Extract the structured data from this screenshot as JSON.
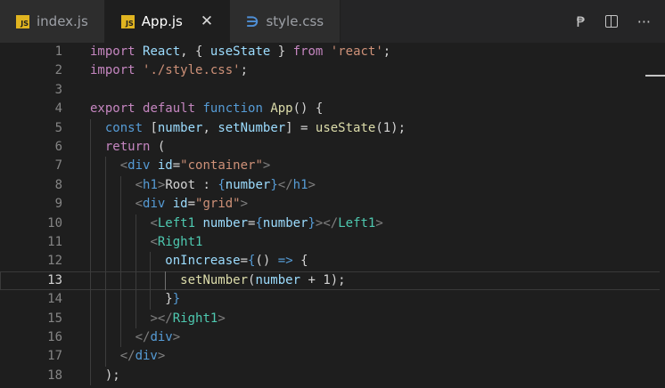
{
  "tabs": [
    {
      "label": "index.js",
      "icon": "js-icon",
      "active": false
    },
    {
      "label": "App.js",
      "icon": "js-icon",
      "active": true
    },
    {
      "label": "style.css",
      "icon": "css-icon",
      "active": false
    }
  ],
  "js_icon_text": "JS",
  "css_icon_glyph": "∋",
  "close_glyph": "✕",
  "more_glyph": "···",
  "preview_glyph": "₱",
  "colors": {
    "keyword": "#c586c0",
    "blue_keyword": "#569cd6",
    "string": "#ce9178",
    "variable": "#9cdcfe",
    "function": "#dcdcaa",
    "component": "#4ec9b0",
    "tag": "#808080",
    "text": "#d4d4d4"
  },
  "current_line": 13,
  "lines": [
    {
      "n": "1",
      "tokens": [
        [
          "import ",
          "keyword"
        ],
        [
          "React",
          "variable"
        ],
        [
          ", { ",
          "text"
        ],
        [
          "useState",
          "variable"
        ],
        [
          " } ",
          "text"
        ],
        [
          "from ",
          "keyword"
        ],
        [
          "'react'",
          "string"
        ],
        [
          ";",
          "text"
        ]
      ]
    },
    {
      "n": "2",
      "tokens": [
        [
          "import ",
          "keyword"
        ],
        [
          "'./style.css'",
          "string"
        ],
        [
          ";",
          "text"
        ]
      ]
    },
    {
      "n": "3",
      "tokens": []
    },
    {
      "n": "4",
      "tokens": [
        [
          "export ",
          "keyword"
        ],
        [
          "default ",
          "keyword"
        ],
        [
          "function ",
          "blue_keyword"
        ],
        [
          "App",
          "function"
        ],
        [
          "() {",
          "text"
        ]
      ]
    },
    {
      "n": "5",
      "tokens": [
        [
          "  ",
          "text"
        ],
        [
          "const ",
          "blue_keyword"
        ],
        [
          "[",
          "text"
        ],
        [
          "number",
          "variable"
        ],
        [
          ", ",
          "text"
        ],
        [
          "setNumber",
          "variable"
        ],
        [
          "] = ",
          "text"
        ],
        [
          "useState",
          "function"
        ],
        [
          "(1);",
          "text"
        ]
      ]
    },
    {
      "n": "6",
      "tokens": [
        [
          "  ",
          "text"
        ],
        [
          "return ",
          "keyword"
        ],
        [
          "(",
          "text"
        ]
      ]
    },
    {
      "n": "7",
      "tokens": [
        [
          "    ",
          "text"
        ],
        [
          "<",
          "tag"
        ],
        [
          "div ",
          "blue_keyword"
        ],
        [
          "id",
          "variable"
        ],
        [
          "=",
          "text"
        ],
        [
          "\"container\"",
          "string"
        ],
        [
          ">",
          "tag"
        ]
      ]
    },
    {
      "n": "8",
      "tokens": [
        [
          "      ",
          "text"
        ],
        [
          "<",
          "tag"
        ],
        [
          "h1",
          "blue_keyword"
        ],
        [
          ">",
          "tag"
        ],
        [
          "Root : ",
          "text"
        ],
        [
          "{",
          "blue_keyword"
        ],
        [
          "number",
          "variable"
        ],
        [
          "}",
          "blue_keyword"
        ],
        [
          "</",
          "tag"
        ],
        [
          "h1",
          "blue_keyword"
        ],
        [
          ">",
          "tag"
        ]
      ]
    },
    {
      "n": "9",
      "tokens": [
        [
          "      ",
          "text"
        ],
        [
          "<",
          "tag"
        ],
        [
          "div ",
          "blue_keyword"
        ],
        [
          "id",
          "variable"
        ],
        [
          "=",
          "text"
        ],
        [
          "\"grid\"",
          "string"
        ],
        [
          ">",
          "tag"
        ]
      ]
    },
    {
      "n": "10",
      "tokens": [
        [
          "        ",
          "text"
        ],
        [
          "<",
          "tag"
        ],
        [
          "Left1 ",
          "component"
        ],
        [
          "number",
          "variable"
        ],
        [
          "=",
          "text"
        ],
        [
          "{",
          "blue_keyword"
        ],
        [
          "number",
          "variable"
        ],
        [
          "}",
          "blue_keyword"
        ],
        [
          "></",
          "tag"
        ],
        [
          "Left1",
          "component"
        ],
        [
          ">",
          "tag"
        ]
      ]
    },
    {
      "n": "11",
      "tokens": [
        [
          "        ",
          "text"
        ],
        [
          "<",
          "tag"
        ],
        [
          "Right1",
          "component"
        ]
      ]
    },
    {
      "n": "12",
      "tokens": [
        [
          "          ",
          "text"
        ],
        [
          "onIncrease",
          "variable"
        ],
        [
          "=",
          "text"
        ],
        [
          "{",
          "blue_keyword"
        ],
        [
          "() ",
          "text"
        ],
        [
          "=> ",
          "blue_keyword"
        ],
        [
          "{",
          "text"
        ]
      ]
    },
    {
      "n": "13",
      "tokens": [
        [
          "            ",
          "text"
        ],
        [
          "setNumber",
          "function"
        ],
        [
          "(",
          "text"
        ],
        [
          "number",
          "variable"
        ],
        [
          " + 1);",
          "text"
        ]
      ]
    },
    {
      "n": "14",
      "tokens": [
        [
          "          ",
          "text"
        ],
        [
          "}",
          "text"
        ],
        [
          "}",
          "blue_keyword"
        ]
      ]
    },
    {
      "n": "15",
      "tokens": [
        [
          "        ",
          "text"
        ],
        [
          "></",
          "tag"
        ],
        [
          "Right1",
          "component"
        ],
        [
          ">",
          "tag"
        ]
      ]
    },
    {
      "n": "16",
      "tokens": [
        [
          "      ",
          "text"
        ],
        [
          "</",
          "tag"
        ],
        [
          "div",
          "blue_keyword"
        ],
        [
          ">",
          "tag"
        ]
      ]
    },
    {
      "n": "17",
      "tokens": [
        [
          "    ",
          "text"
        ],
        [
          "</",
          "tag"
        ],
        [
          "div",
          "blue_keyword"
        ],
        [
          ">",
          "tag"
        ]
      ]
    },
    {
      "n": "18",
      "tokens": [
        [
          "  ",
          "text"
        ],
        [
          ");",
          "text"
        ]
      ]
    }
  ]
}
